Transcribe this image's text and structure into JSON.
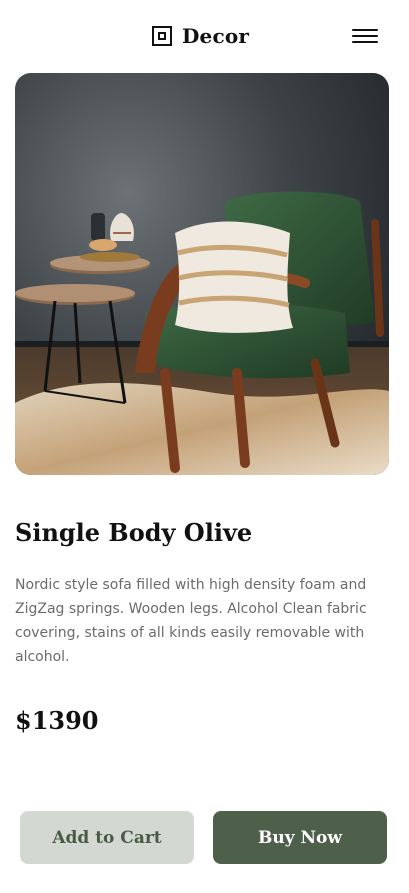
{
  "header": {
    "brand": "Decor",
    "logo_icon": "square-logo-icon",
    "menu_icon": "hamburger-icon"
  },
  "product": {
    "image": "armchair-photo",
    "title": "Single Body Olive",
    "description": "Nordic style sofa filled with high density foam and ZigZag springs. Wooden legs. Alcohol Clean fabric covering, stains of all kinds easily removable with alcohol.",
    "price": "$1390"
  },
  "actions": {
    "add_to_cart": "Add to Cart",
    "buy_now": "Buy Now"
  },
  "colors": {
    "cart_button_bg": "#d3d9d2",
    "cart_button_text": "#4a5a47",
    "buy_button_bg": "#4e5f4a",
    "buy_button_text": "#ffffff",
    "description_text": "#6b6b6b"
  }
}
